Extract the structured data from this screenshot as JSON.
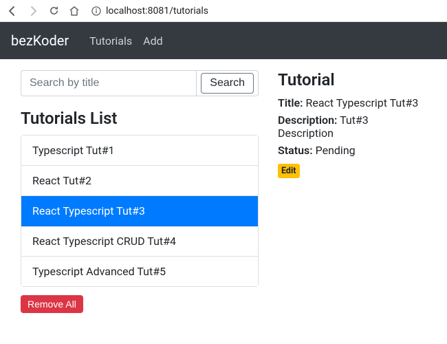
{
  "browser": {
    "url": "localhost:8081/tutorials"
  },
  "navbar": {
    "brand": "bezKoder",
    "links": [
      "Tutorials",
      "Add"
    ]
  },
  "search": {
    "placeholder": "Search by title",
    "button": "Search"
  },
  "list": {
    "heading": "Tutorials List",
    "items": [
      {
        "title": "Typescript Tut#1",
        "active": false
      },
      {
        "title": "React Tut#2",
        "active": false
      },
      {
        "title": "React Typescript Tut#3",
        "active": true
      },
      {
        "title": "React Typescript CRUD Tut#4",
        "active": false
      },
      {
        "title": "Typescript Advanced Tut#5",
        "active": false
      }
    ],
    "remove_all": "Remove All"
  },
  "detail": {
    "heading": "Tutorial",
    "title_label": "Title:",
    "title_value": "React Typescript Tut#3",
    "description_label": "Description:",
    "description_value": "Tut#3 Description",
    "status_label": "Status:",
    "status_value": "Pending",
    "edit": "Edit"
  }
}
